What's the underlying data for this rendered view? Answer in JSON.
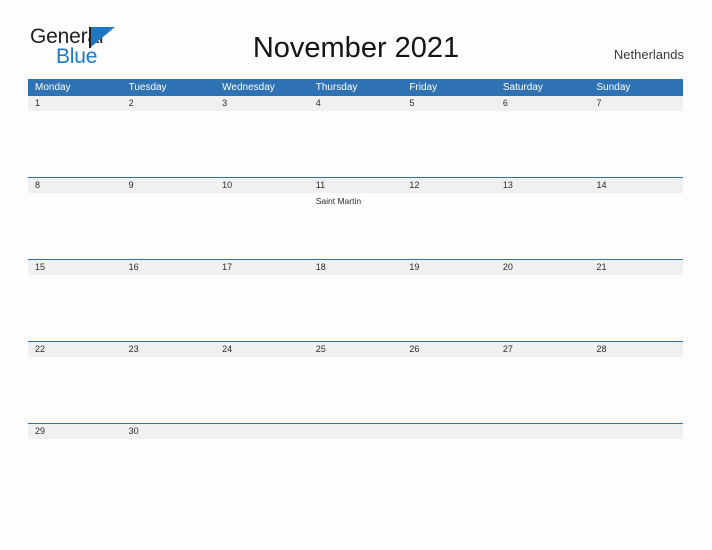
{
  "branding": {
    "name_part1": "General",
    "name_part2": "Blue",
    "flag_icon": "flag-triangle-icon",
    "primary_color": "#1f78c1",
    "text_color": "#231f20"
  },
  "header": {
    "title": "November 2021",
    "locale": "Netherlands"
  },
  "calendar": {
    "header_bg": "#2e72b4",
    "date_band_bg": "#f0f0f0",
    "divider_color": "#2e72b4",
    "weekdays": [
      "Monday",
      "Tuesday",
      "Wednesday",
      "Thursday",
      "Friday",
      "Saturday",
      "Sunday"
    ],
    "weeks": [
      {
        "dates": [
          "1",
          "2",
          "3",
          "4",
          "5",
          "6",
          "7"
        ],
        "events": [
          [],
          [],
          [],
          [],
          [],
          [],
          []
        ]
      },
      {
        "dates": [
          "8",
          "9",
          "10",
          "11",
          "12",
          "13",
          "14"
        ],
        "events": [
          [],
          [],
          [],
          [
            "Saint Martin"
          ],
          [],
          [],
          []
        ]
      },
      {
        "dates": [
          "15",
          "16",
          "17",
          "18",
          "19",
          "20",
          "21"
        ],
        "events": [
          [],
          [],
          [],
          [],
          [],
          [],
          []
        ]
      },
      {
        "dates": [
          "22",
          "23",
          "24",
          "25",
          "26",
          "27",
          "28"
        ],
        "events": [
          [],
          [],
          [],
          [],
          [],
          [],
          []
        ]
      },
      {
        "dates": [
          "29",
          "30",
          "",
          "",
          "",
          "",
          ""
        ],
        "events": [
          [],
          [],
          [],
          [],
          [],
          [],
          []
        ]
      }
    ]
  }
}
